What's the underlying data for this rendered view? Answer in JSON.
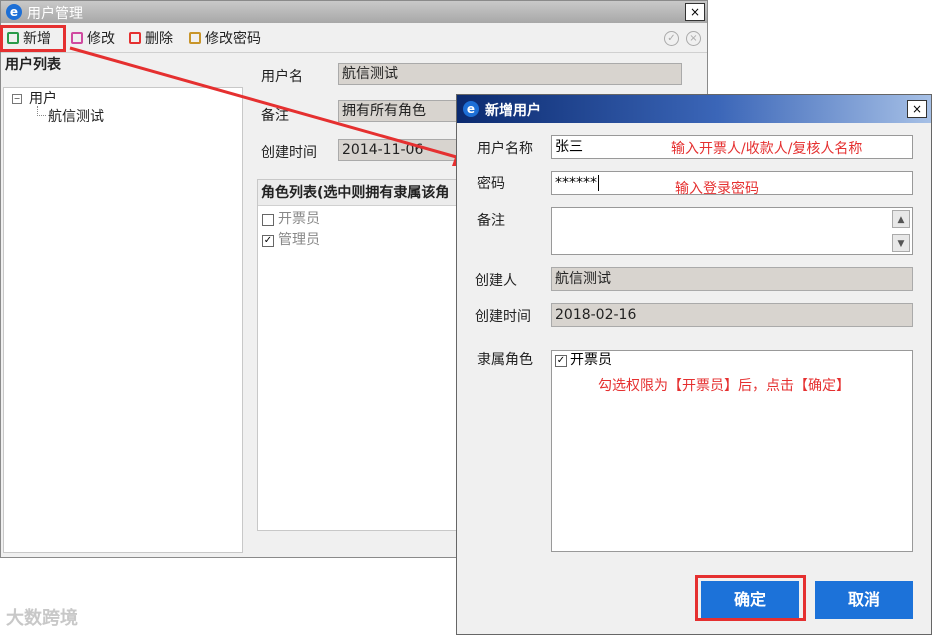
{
  "main_window": {
    "title": "用户管理",
    "close_glyph": "×",
    "toolbar": {
      "add": "新增",
      "edit": "修改",
      "delete": "删除",
      "change_password": "修改密码"
    },
    "left_panel_title": "用户列表",
    "tree": {
      "root": "用户",
      "child": "航信测试"
    },
    "form": {
      "username_label": "用户名",
      "username_value": "航信测试",
      "note_label": "备注",
      "note_value": "拥有所有角色",
      "created_time_label": "创建时间",
      "created_time_value": "2014-11-06"
    },
    "roles_panel": {
      "header": "角色列表(选中则拥有隶属该角",
      "roles": [
        {
          "label": "开票员",
          "checked": false
        },
        {
          "label": "管理员",
          "checked": true
        }
      ]
    }
  },
  "dialog": {
    "title": "新增用户",
    "close_glyph": "×",
    "fields": {
      "username_label": "用户名称",
      "username_value": "张三",
      "username_hint": "输入开票人/收款人/复核人名称",
      "password_label": "密码",
      "password_value": "******",
      "password_hint": "输入登录密码",
      "note_label": "备注",
      "creator_label": "创建人",
      "creator_value": "航信测试",
      "created_time_label": "创建时间",
      "created_time_value": "2018-02-16",
      "role_label": "隶属角色"
    },
    "role_item": {
      "label": "开票员",
      "checked": true
    },
    "role_hint": "勾选权限为【开票员】后，点击【确定】",
    "ok_button": "确定",
    "cancel_button": "取消"
  },
  "watermark": "大数跨境",
  "colors": {
    "annotation_red": "#e53030",
    "button_blue": "#1c72d9",
    "dialog_title_dark": "#0b2a6f"
  }
}
